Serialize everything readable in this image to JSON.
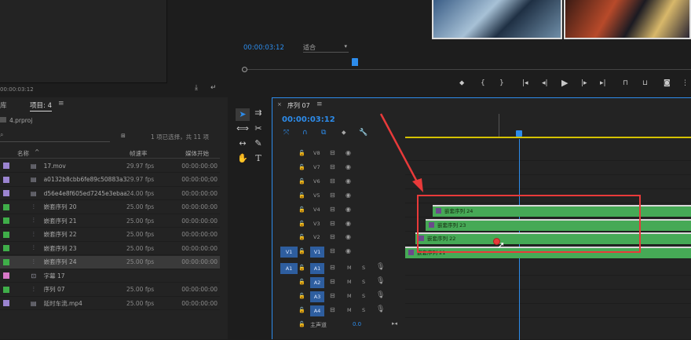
{
  "source_monitor": {
    "timecode": "00:00:03:12"
  },
  "program_monitor": {
    "timecode": "00:00:03:12",
    "zoom": "适合",
    "controls": [
      "marker",
      "in",
      "out",
      "go-in",
      "step-back",
      "play",
      "step-forward",
      "go-out",
      "lift",
      "extract",
      "export-frame"
    ]
  },
  "project_panel": {
    "tab_left": "库",
    "tab_title": "项目: 4",
    "project_file": "4.prproj",
    "selection_info": "1 项已选择，共 11 项",
    "columns": {
      "name": "名称",
      "fps": "帧速率",
      "start": "媒体开始"
    },
    "rows": [
      {
        "color": "#9b84d0",
        "icon": "clip",
        "name": "17.mov",
        "fps": "29.97 fps",
        "start": "00:00:00:00",
        "selected": false
      },
      {
        "color": "#9b84d0",
        "icon": "clip",
        "name": "a0132b8cbb6fe89c50883a3",
        "fps": "29.97 fps",
        "start": "00:00:00;00",
        "selected": false
      },
      {
        "color": "#9b84d0",
        "icon": "clip",
        "name": "d56e4e8f605ed7245e3ebaa",
        "fps": "24.00 fps",
        "start": "00:00:00:00",
        "selected": false
      },
      {
        "color": "#3fae49",
        "icon": "seq",
        "name": "嵌套序列 20",
        "fps": "25.00 fps",
        "start": "00:00:00:00",
        "selected": false
      },
      {
        "color": "#3fae49",
        "icon": "seq",
        "name": "嵌套序列 21",
        "fps": "25.00 fps",
        "start": "00:00:00:00",
        "selected": false
      },
      {
        "color": "#3fae49",
        "icon": "seq",
        "name": "嵌套序列 22",
        "fps": "25.00 fps",
        "start": "00:00:00:00",
        "selected": false
      },
      {
        "color": "#3fae49",
        "icon": "seq",
        "name": "嵌套序列 23",
        "fps": "25.00 fps",
        "start": "00:00:00:00",
        "selected": false
      },
      {
        "color": "#3fae49",
        "icon": "seq",
        "name": "嵌套序列 24",
        "fps": "25.00 fps",
        "start": "00:00:00:00",
        "selected": true
      },
      {
        "color": "#d878c8",
        "icon": "title",
        "name": "字幕 17",
        "fps": "",
        "start": "",
        "selected": false
      },
      {
        "color": "#3fae49",
        "icon": "seq",
        "name": "序列 07",
        "fps": "25.00 fps",
        "start": "00:00:00:00",
        "selected": false
      },
      {
        "color": "#9b84d0",
        "icon": "clip",
        "name": "延时车流.mp4",
        "fps": "25.00 fps",
        "start": "00:00:00:00",
        "selected": false
      }
    ]
  },
  "timeline": {
    "tab_title": "序列 07",
    "timecode": "00:00:03:12",
    "video_tracks": [
      "V8",
      "V7",
      "V6",
      "V5",
      "V4",
      "V3",
      "V2",
      "V1"
    ],
    "audio_tracks": [
      "A1",
      "A2",
      "A3",
      "A4"
    ],
    "source_v": "V1",
    "source_a": "A1",
    "mix_label": "主声道",
    "mix_value": "0.0",
    "mute_label": "M",
    "solo_label": "S",
    "clips": [
      {
        "label": "嵌套序列 24",
        "track": "V4"
      },
      {
        "label": "嵌套序列 23",
        "track": "V3"
      },
      {
        "label": "嵌套序列 22",
        "track": "V2"
      },
      {
        "label": "嵌套序列 21",
        "track": "V1"
      }
    ]
  },
  "colors": {
    "accent": "#2d8ceb",
    "clip_green": "#46a956",
    "highlight_red": "#e83a3a"
  }
}
